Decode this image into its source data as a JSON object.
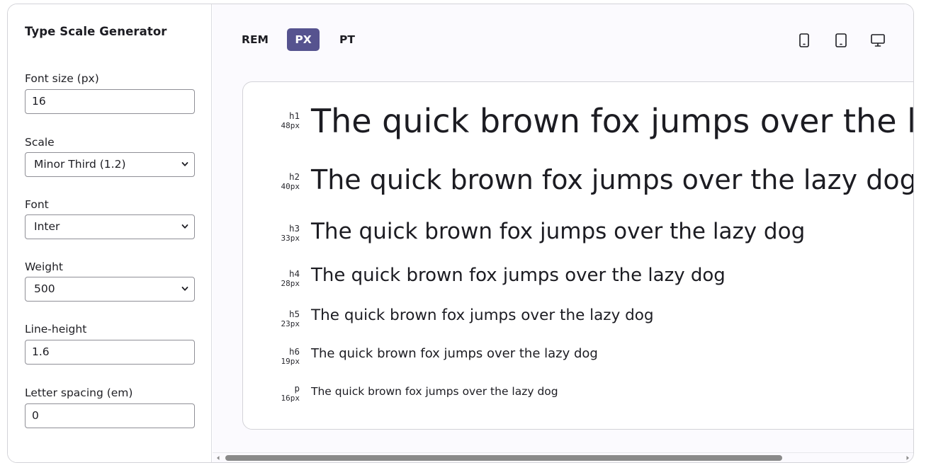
{
  "sidebar": {
    "title": "Type Scale Generator",
    "font_size": {
      "label": "Font size (px)",
      "value": "16"
    },
    "scale": {
      "label": "Scale",
      "value": "Minor Third (1.2)"
    },
    "font": {
      "label": "Font",
      "value": "Inter"
    },
    "weight": {
      "label": "Weight",
      "value": "500"
    },
    "line_height": {
      "label": "Line-height",
      "value": "1.6"
    },
    "letter_spacing": {
      "label": "Letter spacing (em)",
      "value": "0"
    }
  },
  "toolbar": {
    "units": [
      {
        "label": "REM",
        "active": false
      },
      {
        "label": "PX",
        "active": true
      },
      {
        "label": "PT",
        "active": false
      }
    ],
    "devices": [
      "phone-icon",
      "tablet-icon",
      "desktop-icon"
    ],
    "accent_color": "#56538f"
  },
  "preview": {
    "sample_text": "The quick brown fox jumps over the lazy dog",
    "rows": [
      {
        "tag": "h1",
        "size": "48px"
      },
      {
        "tag": "h2",
        "size": "40px"
      },
      {
        "tag": "h3",
        "size": "33px"
      },
      {
        "tag": "h4",
        "size": "28px"
      },
      {
        "tag": "h5",
        "size": "23px"
      },
      {
        "tag": "h6",
        "size": "19px"
      },
      {
        "tag": "p",
        "size": "16px"
      }
    ]
  }
}
